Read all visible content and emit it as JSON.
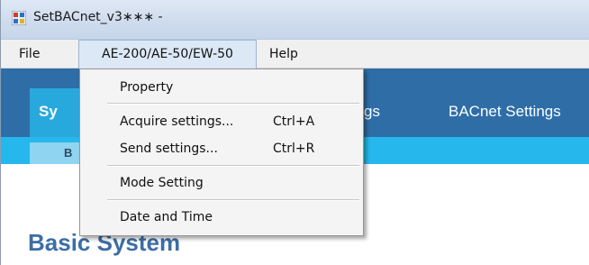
{
  "window": {
    "title": "SetBACnet_v3∗∗∗ -"
  },
  "menubar": {
    "items": [
      {
        "label": "File"
      },
      {
        "label": "AE-200/AE-50/EW-50"
      },
      {
        "label": "Help"
      }
    ]
  },
  "dropdown": {
    "items": [
      {
        "label": "Property",
        "shortcut": ""
      },
      {
        "label": "Acquire settings...",
        "shortcut": "Ctrl+A"
      },
      {
        "label": "Send settings...",
        "shortcut": "Ctrl+R"
      },
      {
        "label": "Mode Setting",
        "shortcut": ""
      },
      {
        "label": "Date and Time",
        "shortcut": ""
      }
    ]
  },
  "tabs": {
    "system_partial": "Sy",
    "settings_partial": "gs",
    "bacnet": "BACnet Settings"
  },
  "subtabs": {
    "basic_partial": "B"
  },
  "main": {
    "heading": "Basic System"
  },
  "colors": {
    "header_band": "#2f6da7",
    "selected_tab": "#28a9de",
    "subbar": "#26b8ec",
    "heading": "#3d6ea5"
  }
}
